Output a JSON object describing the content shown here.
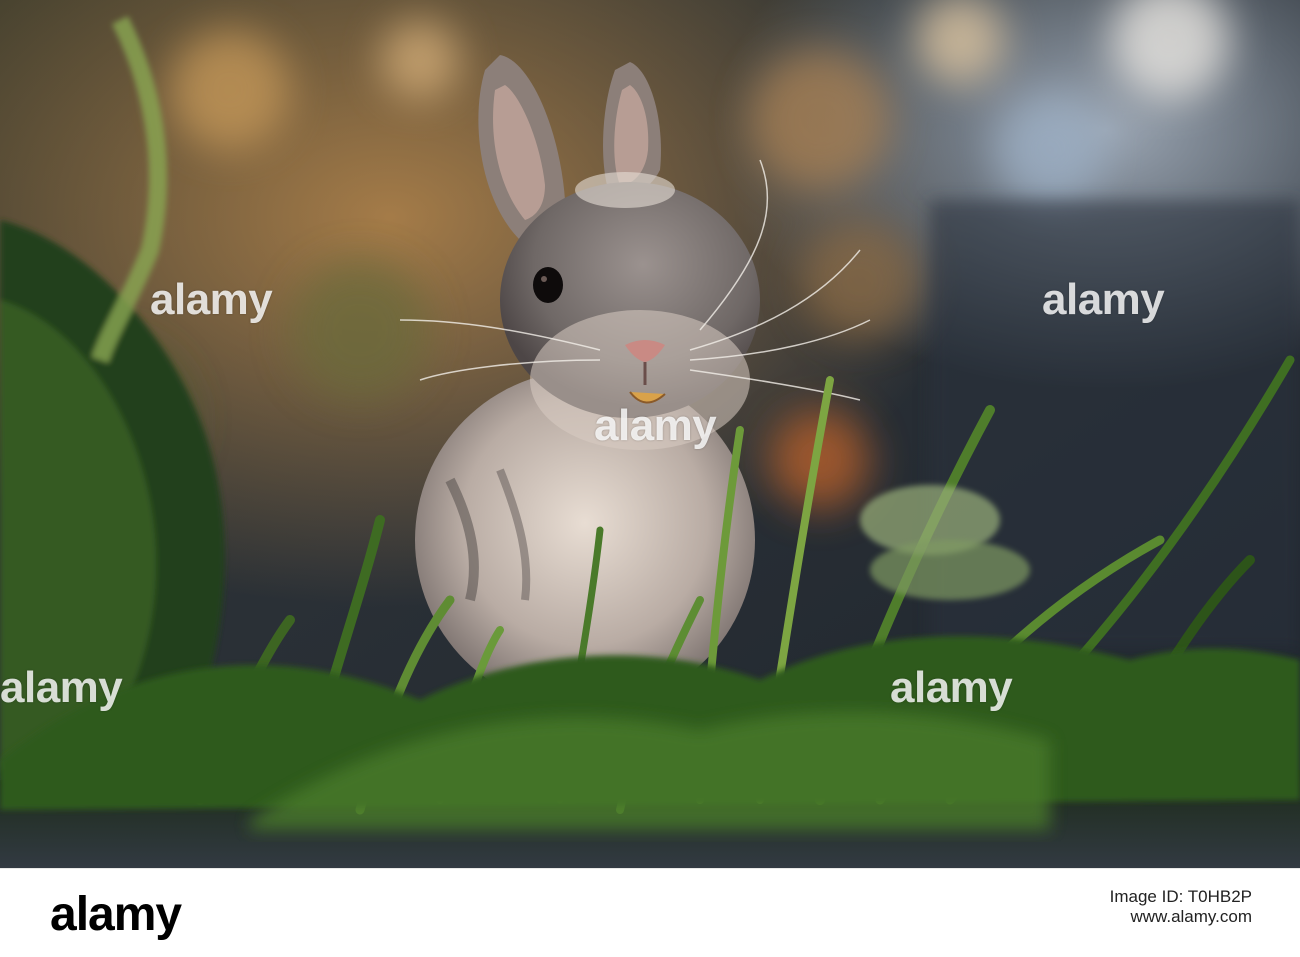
{
  "photo": {
    "subject": "rabbit-in-grass"
  },
  "watermark": {
    "text": "alamy"
  },
  "footer": {
    "logo_text": "alamy",
    "image_id_label": "Image ID: T0HB2P",
    "url_text": "www.alamy.com"
  },
  "colors": {
    "background_dark": "#2c3440",
    "bokeh_warm": "#c88a4a",
    "grass_green": "#4e7a2e",
    "fur_grey": "#7d7470",
    "fur_light": "#d9ccc4"
  }
}
